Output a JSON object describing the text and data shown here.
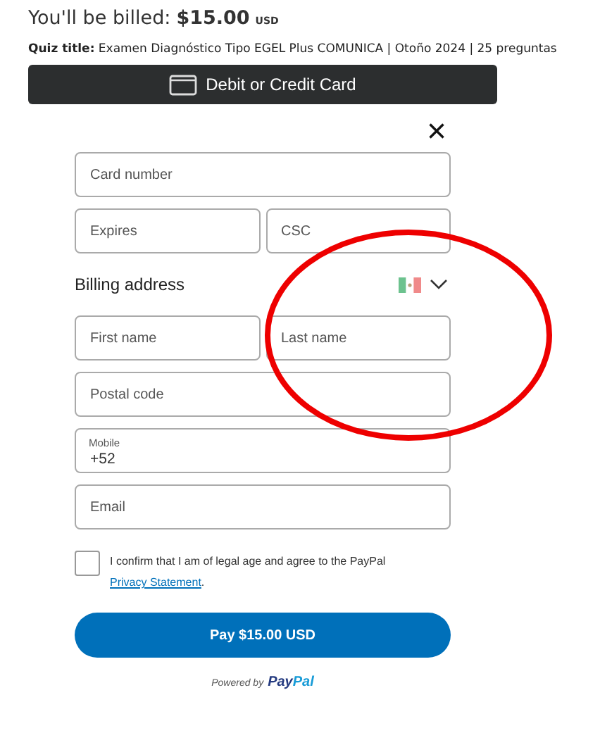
{
  "billing": {
    "label": "You'll be billed:",
    "amount": "$15.00",
    "currency": "USD"
  },
  "quiz_title": "**Quiz title:** Examen Diagnóstico Tipo EGEL Plus COMUNICA | Otoño 2024 | 25 preguntas",
  "card_button": {
    "label": "Debit or Credit Card"
  },
  "close": {
    "symbol": "×"
  },
  "card_rows": [
    [
      {
        "placeholder": "Card number"
      }
    ],
    [
      {
        "placeholder": "Expires"
      },
      {
        "placeholder": "CSC"
      }
    ]
  ],
  "billing_address": {
    "title": "Billing address"
  },
  "address_rows": [
    [
      {
        "placeholder": "First name"
      },
      {
        "placeholder": "Last name"
      }
    ],
    [
      {
        "placeholder": "Postal code"
      }
    ],
    [
      {
        "label": "Mobile",
        "value": "+52"
      }
    ],
    [
      {
        "placeholder": "Email"
      }
    ]
  ],
  "consent": {
    "checked": false,
    "text": "I confirm that I am of legal age and agree to the PayPal",
    "link": "Privacy Statement",
    "end": "."
  },
  "pay_button": {
    "label": "Pay $15.00 USD"
  },
  "powered_by": {
    "label": "Powered by",
    "brand_a": "Pay",
    "brand_b": "Pal"
  },
  "annotation": {
    "kind": "ellipse"
  }
}
